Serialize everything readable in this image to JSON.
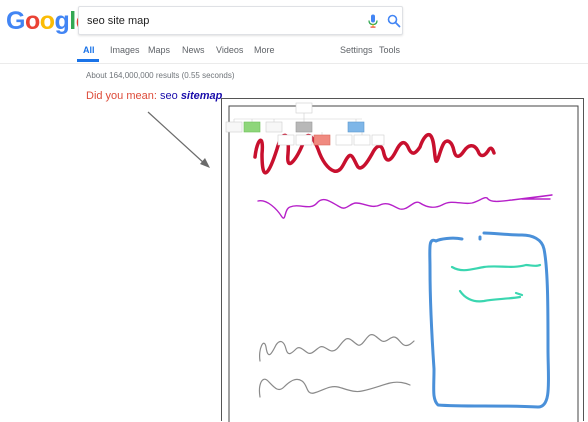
{
  "logo": {
    "letters": [
      "G",
      "o",
      "o",
      "g",
      "l",
      "e"
    ],
    "colors": [
      "#4285F4",
      "#EA4335",
      "#FBBC05",
      "#4285F4",
      "#34A853",
      "#EA4335"
    ]
  },
  "search": {
    "query": "seo site map"
  },
  "tabs": {
    "all": "All",
    "images": "Images",
    "maps": "Maps",
    "news": "News",
    "videos": "Videos",
    "more": "More",
    "settings": "Settings",
    "tools": "Tools"
  },
  "results": {
    "stats": "About 164,000,000 results (0.55 seconds)"
  },
  "did_you_mean": {
    "label": "Did you mean:",
    "prefix": "seo",
    "suggestion": "sitemap"
  },
  "colors": {
    "accent": "#1a73e8",
    "link": "#1a0dab",
    "did_you_mean": "#dd4b39",
    "scribble_red": "#c8102e",
    "scribble_purple": "#b620c9",
    "scribble_blue": "#4a90d9",
    "scribble_teal": "#3ad6b0",
    "scribble_gray": "#8a8a8a"
  }
}
